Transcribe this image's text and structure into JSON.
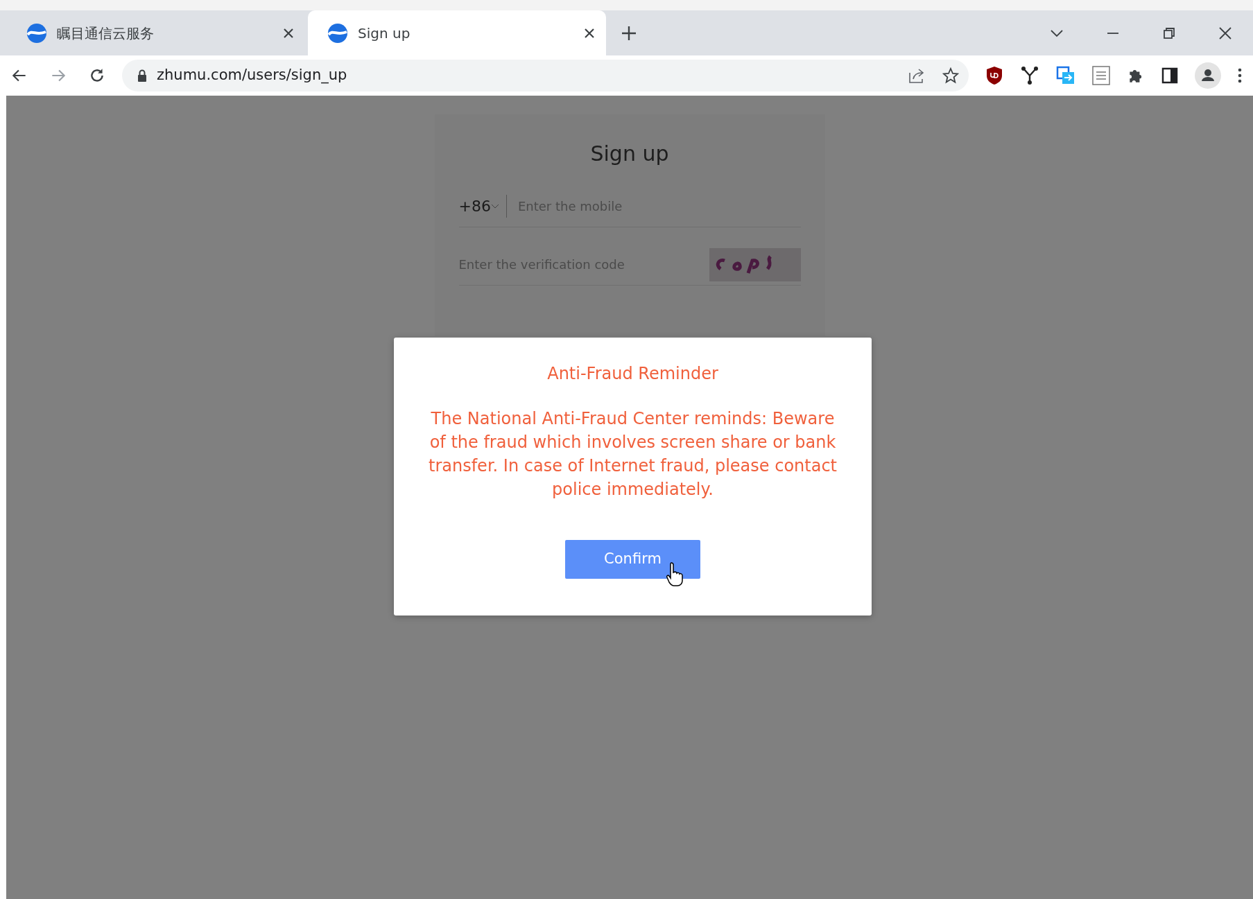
{
  "browser": {
    "tabs": [
      {
        "title": "瞩目通信云服务",
        "selected": false
      },
      {
        "title": "Sign up",
        "selected": true
      }
    ],
    "address": "zhumu.com/users/sign_up"
  },
  "signup": {
    "title": "Sign up",
    "country_code": "+86",
    "mobile": {
      "placeholder": "Enter the mobile"
    },
    "verification": {
      "placeholder": "Enter the verification code"
    }
  },
  "dialog": {
    "title": "Anti-Fraud Reminder",
    "message": "The National Anti-Fraud Center reminds: Beware of the fraud which involves screen share or bank transfer. In case of Internet fraud, please contact police immediately.",
    "button": "Confirm"
  }
}
